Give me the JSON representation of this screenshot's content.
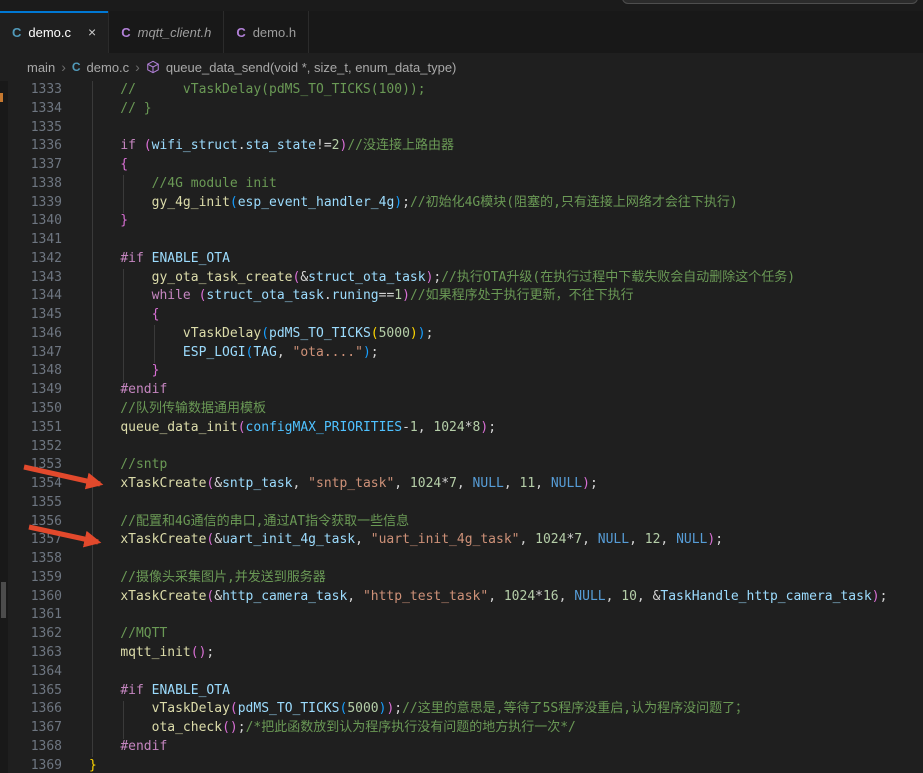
{
  "title_bar": {
    "searchbox_visible": true
  },
  "tabs": [
    {
      "label": "demo.c",
      "icon": "c-file-icon",
      "icon_color": "#519aba",
      "active": true,
      "preview": false,
      "close_glyph": "×"
    },
    {
      "label": "mqtt_client.h",
      "icon": "c-file-icon",
      "icon_color": "#b180d7",
      "active": false,
      "preview": true
    },
    {
      "label": "demo.h",
      "icon": "c-file-icon",
      "icon_color": "#b180d7",
      "active": false,
      "preview": false
    }
  ],
  "breadcrumb": {
    "items": [
      "main",
      "demo.c",
      "queue_data_send(void *, size_t, enum_data_type)"
    ],
    "separator": "›",
    "file_icon_color": "#519aba",
    "symbol_icon_color": "#b180d7"
  },
  "colors": {
    "cm": "#6A9955",
    "kw": "#C586C0",
    "fn": "#DCDCAA",
    "var": "#9CDCFE",
    "str": "#CE9178",
    "num": "#B5CEA8",
    "kw2": "#569CD6",
    "cons": "#4FC1FF",
    "pl": "#D4D4D4",
    "b1": "#FFD700",
    "b2": "#DA70D6",
    "b3": "#179FFF",
    "accent": "#0078d4",
    "arrow": "#e2492c",
    "line_number": "#6e7681"
  },
  "editor": {
    "lines": [
      {
        "n": 1333,
        "t": [
          [
            "cm",
            "    //      vTaskDelay(pdMS_TO_TICKS(100));"
          ]
        ]
      },
      {
        "n": 1334,
        "t": [
          [
            "cm",
            "    // }"
          ]
        ]
      },
      {
        "n": 1335,
        "t": []
      },
      {
        "n": 1336,
        "t": [
          [
            "pl",
            "    "
          ],
          [
            "kw",
            "if"
          ],
          [
            "pl",
            " "
          ],
          [
            "b2",
            "("
          ],
          [
            "var",
            "wifi_struct"
          ],
          [
            "pl",
            "."
          ],
          [
            "var",
            "sta_state"
          ],
          [
            "pl",
            "!="
          ],
          [
            "num",
            "2"
          ],
          [
            "b2",
            ")"
          ],
          [
            "cm",
            "//没连接上路由器"
          ]
        ]
      },
      {
        "n": 1337,
        "t": [
          [
            "b2",
            "    {"
          ]
        ]
      },
      {
        "n": 1338,
        "t": [
          [
            "cm",
            "        //4G module init"
          ]
        ]
      },
      {
        "n": 1339,
        "t": [
          [
            "pl",
            "        "
          ],
          [
            "fn",
            "gy_4g_init"
          ],
          [
            "b3",
            "("
          ],
          [
            "var",
            "esp_event_handler_4g"
          ],
          [
            "b3",
            ")"
          ],
          [
            "pl",
            ";"
          ],
          [
            "cm",
            "//初始化4G模块(阻塞的,只有连接上网络才会往下执行)"
          ]
        ]
      },
      {
        "n": 1340,
        "t": [
          [
            "b2",
            "    }"
          ]
        ]
      },
      {
        "n": 1341,
        "t": []
      },
      {
        "n": 1342,
        "t": [
          [
            "pl",
            "    "
          ],
          [
            "kw",
            "#if"
          ],
          [
            "pl",
            " "
          ],
          [
            "var",
            "ENABLE_OTA"
          ]
        ]
      },
      {
        "n": 1343,
        "t": [
          [
            "pl",
            "        "
          ],
          [
            "fn",
            "gy_ota_task_create"
          ],
          [
            "b2",
            "("
          ],
          [
            "pl",
            "&"
          ],
          [
            "var",
            "struct_ota_task"
          ],
          [
            "b2",
            ")"
          ],
          [
            "pl",
            ";"
          ],
          [
            "cm",
            "//执行OTA升级(在执行过程中下载失败会自动删除这个任务)"
          ]
        ]
      },
      {
        "n": 1344,
        "t": [
          [
            "pl",
            "        "
          ],
          [
            "kw",
            "while"
          ],
          [
            "pl",
            " "
          ],
          [
            "b2",
            "("
          ],
          [
            "var",
            "struct_ota_task"
          ],
          [
            "pl",
            "."
          ],
          [
            "var",
            "runing"
          ],
          [
            "pl",
            "=="
          ],
          [
            "num",
            "1"
          ],
          [
            "b2",
            ")"
          ],
          [
            "cm",
            "//如果程序处于执行更新，不往下执行"
          ]
        ]
      },
      {
        "n": 1345,
        "t": [
          [
            "b2",
            "        {"
          ]
        ]
      },
      {
        "n": 1346,
        "t": [
          [
            "pl",
            "            "
          ],
          [
            "fn",
            "vTaskDelay"
          ],
          [
            "b3",
            "("
          ],
          [
            "var",
            "pdMS_TO_TICKS"
          ],
          [
            "b1",
            "("
          ],
          [
            "num",
            "5000"
          ],
          [
            "b1",
            ")"
          ],
          [
            "b3",
            ")"
          ],
          [
            "pl",
            ";"
          ]
        ]
      },
      {
        "n": 1347,
        "t": [
          [
            "pl",
            "            "
          ],
          [
            "var",
            "ESP_LOGI"
          ],
          [
            "b3",
            "("
          ],
          [
            "var",
            "TAG"
          ],
          [
            "pl",
            ", "
          ],
          [
            "str",
            "\"ota....\""
          ],
          [
            "b3",
            ")"
          ],
          [
            "pl",
            ";"
          ]
        ]
      },
      {
        "n": 1348,
        "t": [
          [
            "b2",
            "        }"
          ]
        ]
      },
      {
        "n": 1349,
        "t": [
          [
            "pl",
            "    "
          ],
          [
            "kw",
            "#endif"
          ]
        ]
      },
      {
        "n": 1350,
        "t": [
          [
            "cm",
            "    //队列传输数据通用模板"
          ]
        ]
      },
      {
        "n": 1351,
        "t": [
          [
            "pl",
            "    "
          ],
          [
            "fn",
            "queue_data_init"
          ],
          [
            "b2",
            "("
          ],
          [
            "cons",
            "configMAX_PRIORITIES"
          ],
          [
            "pl",
            "-"
          ],
          [
            "num",
            "1"
          ],
          [
            "pl",
            ", "
          ],
          [
            "num",
            "1024"
          ],
          [
            "pl",
            "*"
          ],
          [
            "num",
            "8"
          ],
          [
            "b2",
            ")"
          ],
          [
            "pl",
            ";"
          ]
        ]
      },
      {
        "n": 1352,
        "t": []
      },
      {
        "n": 1353,
        "t": [
          [
            "cm",
            "    //sntp"
          ]
        ]
      },
      {
        "n": 1354,
        "t": [
          [
            "pl",
            "    "
          ],
          [
            "fn",
            "xTaskCreate"
          ],
          [
            "b2",
            "("
          ],
          [
            "pl",
            "&"
          ],
          [
            "var",
            "sntp_task"
          ],
          [
            "pl",
            ", "
          ],
          [
            "str",
            "\"sntp_task\""
          ],
          [
            "pl",
            ", "
          ],
          [
            "num",
            "1024"
          ],
          [
            "pl",
            "*"
          ],
          [
            "num",
            "7"
          ],
          [
            "pl",
            ", "
          ],
          [
            "kw2",
            "NULL"
          ],
          [
            "pl",
            ", "
          ],
          [
            "num",
            "11"
          ],
          [
            "pl",
            ", "
          ],
          [
            "kw2",
            "NULL"
          ],
          [
            "b2",
            ")"
          ],
          [
            "pl",
            ";"
          ]
        ]
      },
      {
        "n": 1355,
        "t": []
      },
      {
        "n": 1356,
        "t": [
          [
            "cm",
            "    //配置和4G通信的串口,通过AT指令获取一些信息"
          ]
        ]
      },
      {
        "n": 1357,
        "t": [
          [
            "pl",
            "    "
          ],
          [
            "fn",
            "xTaskCreate"
          ],
          [
            "b2",
            "("
          ],
          [
            "pl",
            "&"
          ],
          [
            "var",
            "uart_init_4g_task"
          ],
          [
            "pl",
            ", "
          ],
          [
            "str",
            "\"uart_init_4g_task\""
          ],
          [
            "pl",
            ", "
          ],
          [
            "num",
            "1024"
          ],
          [
            "pl",
            "*"
          ],
          [
            "num",
            "7"
          ],
          [
            "pl",
            ", "
          ],
          [
            "kw2",
            "NULL"
          ],
          [
            "pl",
            ", "
          ],
          [
            "num",
            "12"
          ],
          [
            "pl",
            ", "
          ],
          [
            "kw2",
            "NULL"
          ],
          [
            "b2",
            ")"
          ],
          [
            "pl",
            ";"
          ]
        ]
      },
      {
        "n": 1358,
        "t": []
      },
      {
        "n": 1359,
        "t": [
          [
            "cm",
            "    //摄像头采集图片,并发送到服务器"
          ]
        ]
      },
      {
        "n": 1360,
        "t": [
          [
            "pl",
            "    "
          ],
          [
            "fn",
            "xTaskCreate"
          ],
          [
            "b2",
            "("
          ],
          [
            "pl",
            "&"
          ],
          [
            "var",
            "http_camera_task"
          ],
          [
            "pl",
            ", "
          ],
          [
            "str",
            "\"http_test_task\""
          ],
          [
            "pl",
            ", "
          ],
          [
            "num",
            "1024"
          ],
          [
            "pl",
            "*"
          ],
          [
            "num",
            "16"
          ],
          [
            "pl",
            ", "
          ],
          [
            "kw2",
            "NULL"
          ],
          [
            "pl",
            ", "
          ],
          [
            "num",
            "10"
          ],
          [
            "pl",
            ", "
          ],
          [
            "pl",
            "&"
          ],
          [
            "var",
            "TaskHandle_http_camera_task"
          ],
          [
            "b2",
            ")"
          ],
          [
            "pl",
            ";"
          ]
        ]
      },
      {
        "n": 1361,
        "t": []
      },
      {
        "n": 1362,
        "t": [
          [
            "cm",
            "    //MQTT"
          ]
        ]
      },
      {
        "n": 1363,
        "t": [
          [
            "pl",
            "    "
          ],
          [
            "fn",
            "mqtt_init"
          ],
          [
            "b2",
            "("
          ],
          [
            "b2",
            ")"
          ],
          [
            "pl",
            ";"
          ]
        ]
      },
      {
        "n": 1364,
        "t": []
      },
      {
        "n": 1365,
        "t": [
          [
            "pl",
            "    "
          ],
          [
            "kw",
            "#if"
          ],
          [
            "pl",
            " "
          ],
          [
            "var",
            "ENABLE_OTA"
          ]
        ]
      },
      {
        "n": 1366,
        "t": [
          [
            "pl",
            "        "
          ],
          [
            "fn",
            "vTaskDelay"
          ],
          [
            "b2",
            "("
          ],
          [
            "var",
            "pdMS_TO_TICKS"
          ],
          [
            "b3",
            "("
          ],
          [
            "num",
            "5000"
          ],
          [
            "b3",
            ")"
          ],
          [
            "b2",
            ")"
          ],
          [
            "pl",
            ";"
          ],
          [
            "cm",
            "//这里的意思是,等待了5S程序没重启,认为程序没问题了；"
          ]
        ]
      },
      {
        "n": 1367,
        "t": [
          [
            "pl",
            "        "
          ],
          [
            "fn",
            "ota_check"
          ],
          [
            "b2",
            "("
          ],
          [
            "b2",
            ")"
          ],
          [
            "pl",
            ";"
          ],
          [
            "cm",
            "/*把此函数放到认为程序执行没有问题的地方执行一次*/"
          ]
        ]
      },
      {
        "n": 1368,
        "t": [
          [
            "pl",
            "    "
          ],
          [
            "kw",
            "#endif"
          ]
        ]
      },
      {
        "n": 1369,
        "t": [
          [
            "b1",
            "}"
          ]
        ]
      }
    ]
  }
}
